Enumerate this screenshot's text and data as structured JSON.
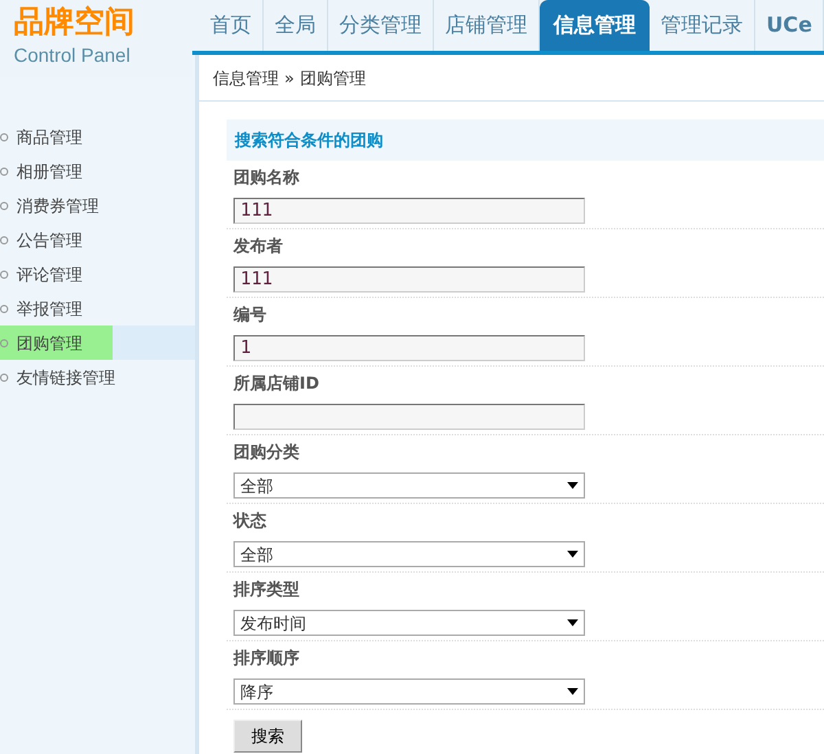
{
  "logo": {
    "title": "品牌空间",
    "subtitle": "Control Panel"
  },
  "nav": [
    {
      "label": "首页",
      "selected": false
    },
    {
      "label": "全局",
      "selected": false
    },
    {
      "label": "分类管理",
      "selected": false
    },
    {
      "label": "店铺管理",
      "selected": false
    },
    {
      "label": "信息管理",
      "selected": true
    },
    {
      "label": "管理记录",
      "selected": false
    },
    {
      "label": "UCe",
      "selected": false
    }
  ],
  "sidebar": {
    "items": [
      {
        "label": "商品管理",
        "selected": false
      },
      {
        "label": "相册管理",
        "selected": false
      },
      {
        "label": "消费券管理",
        "selected": false
      },
      {
        "label": "公告管理",
        "selected": false
      },
      {
        "label": "评论管理",
        "selected": false
      },
      {
        "label": "举报管理",
        "selected": false
      },
      {
        "label": "团购管理",
        "selected": true
      },
      {
        "label": "友情链接管理",
        "selected": false
      }
    ]
  },
  "breadcrumb": [
    "信息管理",
    "»",
    "团购管理"
  ],
  "form": {
    "title": "搜索符合条件的团购",
    "fields": [
      {
        "kind": "text",
        "label": "团购名称",
        "value": "111"
      },
      {
        "kind": "text",
        "label": "发布者",
        "value": "111"
      },
      {
        "kind": "text",
        "label": "编号",
        "value": "1"
      },
      {
        "kind": "text",
        "label": "所属店铺ID"
      },
      {
        "kind": "select",
        "label": "团购分类",
        "value": "全部"
      },
      {
        "kind": "select",
        "label": "状态",
        "value": "全部"
      },
      {
        "kind": "select",
        "label": "排序类型",
        "value": "发布时间"
      },
      {
        "kind": "select",
        "label": "排序顺序",
        "value": "降序"
      }
    ],
    "submit": "搜索"
  }
}
